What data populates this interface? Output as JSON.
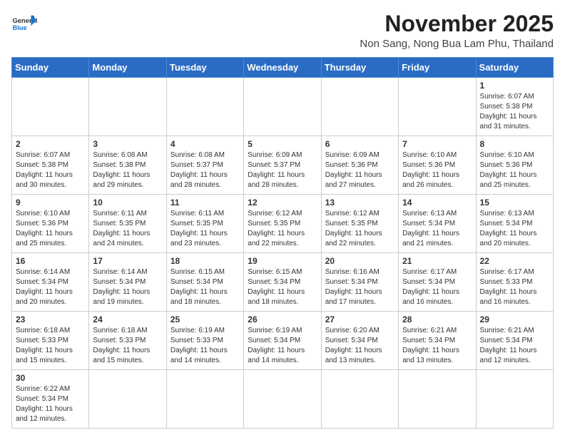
{
  "header": {
    "logo_general": "General",
    "logo_blue": "Blue",
    "month_year": "November 2025",
    "location": "Non Sang, Nong Bua Lam Phu, Thailand"
  },
  "days_of_week": [
    "Sunday",
    "Monday",
    "Tuesday",
    "Wednesday",
    "Thursday",
    "Friday",
    "Saturday"
  ],
  "weeks": [
    [
      {
        "day": "",
        "info": ""
      },
      {
        "day": "",
        "info": ""
      },
      {
        "day": "",
        "info": ""
      },
      {
        "day": "",
        "info": ""
      },
      {
        "day": "",
        "info": ""
      },
      {
        "day": "",
        "info": ""
      },
      {
        "day": "1",
        "info": "Sunrise: 6:07 AM\nSunset: 5:38 PM\nDaylight: 11 hours\nand 31 minutes."
      }
    ],
    [
      {
        "day": "2",
        "info": "Sunrise: 6:07 AM\nSunset: 5:38 PM\nDaylight: 11 hours\nand 30 minutes."
      },
      {
        "day": "3",
        "info": "Sunrise: 6:08 AM\nSunset: 5:38 PM\nDaylight: 11 hours\nand 29 minutes."
      },
      {
        "day": "4",
        "info": "Sunrise: 6:08 AM\nSunset: 5:37 PM\nDaylight: 11 hours\nand 28 minutes."
      },
      {
        "day": "5",
        "info": "Sunrise: 6:09 AM\nSunset: 5:37 PM\nDaylight: 11 hours\nand 28 minutes."
      },
      {
        "day": "6",
        "info": "Sunrise: 6:09 AM\nSunset: 5:36 PM\nDaylight: 11 hours\nand 27 minutes."
      },
      {
        "day": "7",
        "info": "Sunrise: 6:10 AM\nSunset: 5:36 PM\nDaylight: 11 hours\nand 26 minutes."
      },
      {
        "day": "8",
        "info": "Sunrise: 6:10 AM\nSunset: 5:36 PM\nDaylight: 11 hours\nand 25 minutes."
      }
    ],
    [
      {
        "day": "9",
        "info": "Sunrise: 6:10 AM\nSunset: 5:36 PM\nDaylight: 11 hours\nand 25 minutes."
      },
      {
        "day": "10",
        "info": "Sunrise: 6:11 AM\nSunset: 5:35 PM\nDaylight: 11 hours\nand 24 minutes."
      },
      {
        "day": "11",
        "info": "Sunrise: 6:11 AM\nSunset: 5:35 PM\nDaylight: 11 hours\nand 23 minutes."
      },
      {
        "day": "12",
        "info": "Sunrise: 6:12 AM\nSunset: 5:35 PM\nDaylight: 11 hours\nand 22 minutes."
      },
      {
        "day": "13",
        "info": "Sunrise: 6:12 AM\nSunset: 5:35 PM\nDaylight: 11 hours\nand 22 minutes."
      },
      {
        "day": "14",
        "info": "Sunrise: 6:13 AM\nSunset: 5:34 PM\nDaylight: 11 hours\nand 21 minutes."
      },
      {
        "day": "15",
        "info": "Sunrise: 6:13 AM\nSunset: 5:34 PM\nDaylight: 11 hours\nand 20 minutes."
      }
    ],
    [
      {
        "day": "16",
        "info": "Sunrise: 6:14 AM\nSunset: 5:34 PM\nDaylight: 11 hours\nand 20 minutes."
      },
      {
        "day": "17",
        "info": "Sunrise: 6:14 AM\nSunset: 5:34 PM\nDaylight: 11 hours\nand 19 minutes."
      },
      {
        "day": "18",
        "info": "Sunrise: 6:15 AM\nSunset: 5:34 PM\nDaylight: 11 hours\nand 18 minutes."
      },
      {
        "day": "19",
        "info": "Sunrise: 6:15 AM\nSunset: 5:34 PM\nDaylight: 11 hours\nand 18 minutes."
      },
      {
        "day": "20",
        "info": "Sunrise: 6:16 AM\nSunset: 5:34 PM\nDaylight: 11 hours\nand 17 minutes."
      },
      {
        "day": "21",
        "info": "Sunrise: 6:17 AM\nSunset: 5:34 PM\nDaylight: 11 hours\nand 16 minutes."
      },
      {
        "day": "22",
        "info": "Sunrise: 6:17 AM\nSunset: 5:33 PM\nDaylight: 11 hours\nand 16 minutes."
      }
    ],
    [
      {
        "day": "23",
        "info": "Sunrise: 6:18 AM\nSunset: 5:33 PM\nDaylight: 11 hours\nand 15 minutes."
      },
      {
        "day": "24",
        "info": "Sunrise: 6:18 AM\nSunset: 5:33 PM\nDaylight: 11 hours\nand 15 minutes."
      },
      {
        "day": "25",
        "info": "Sunrise: 6:19 AM\nSunset: 5:33 PM\nDaylight: 11 hours\nand 14 minutes."
      },
      {
        "day": "26",
        "info": "Sunrise: 6:19 AM\nSunset: 5:34 PM\nDaylight: 11 hours\nand 14 minutes."
      },
      {
        "day": "27",
        "info": "Sunrise: 6:20 AM\nSunset: 5:34 PM\nDaylight: 11 hours\nand 13 minutes."
      },
      {
        "day": "28",
        "info": "Sunrise: 6:21 AM\nSunset: 5:34 PM\nDaylight: 11 hours\nand 13 minutes."
      },
      {
        "day": "29",
        "info": "Sunrise: 6:21 AM\nSunset: 5:34 PM\nDaylight: 11 hours\nand 12 minutes."
      }
    ],
    [
      {
        "day": "30",
        "info": "Sunrise: 6:22 AM\nSunset: 5:34 PM\nDaylight: 11 hours\nand 12 minutes."
      },
      {
        "day": "",
        "info": ""
      },
      {
        "day": "",
        "info": ""
      },
      {
        "day": "",
        "info": ""
      },
      {
        "day": "",
        "info": ""
      },
      {
        "day": "",
        "info": ""
      },
      {
        "day": "",
        "info": ""
      }
    ]
  ]
}
